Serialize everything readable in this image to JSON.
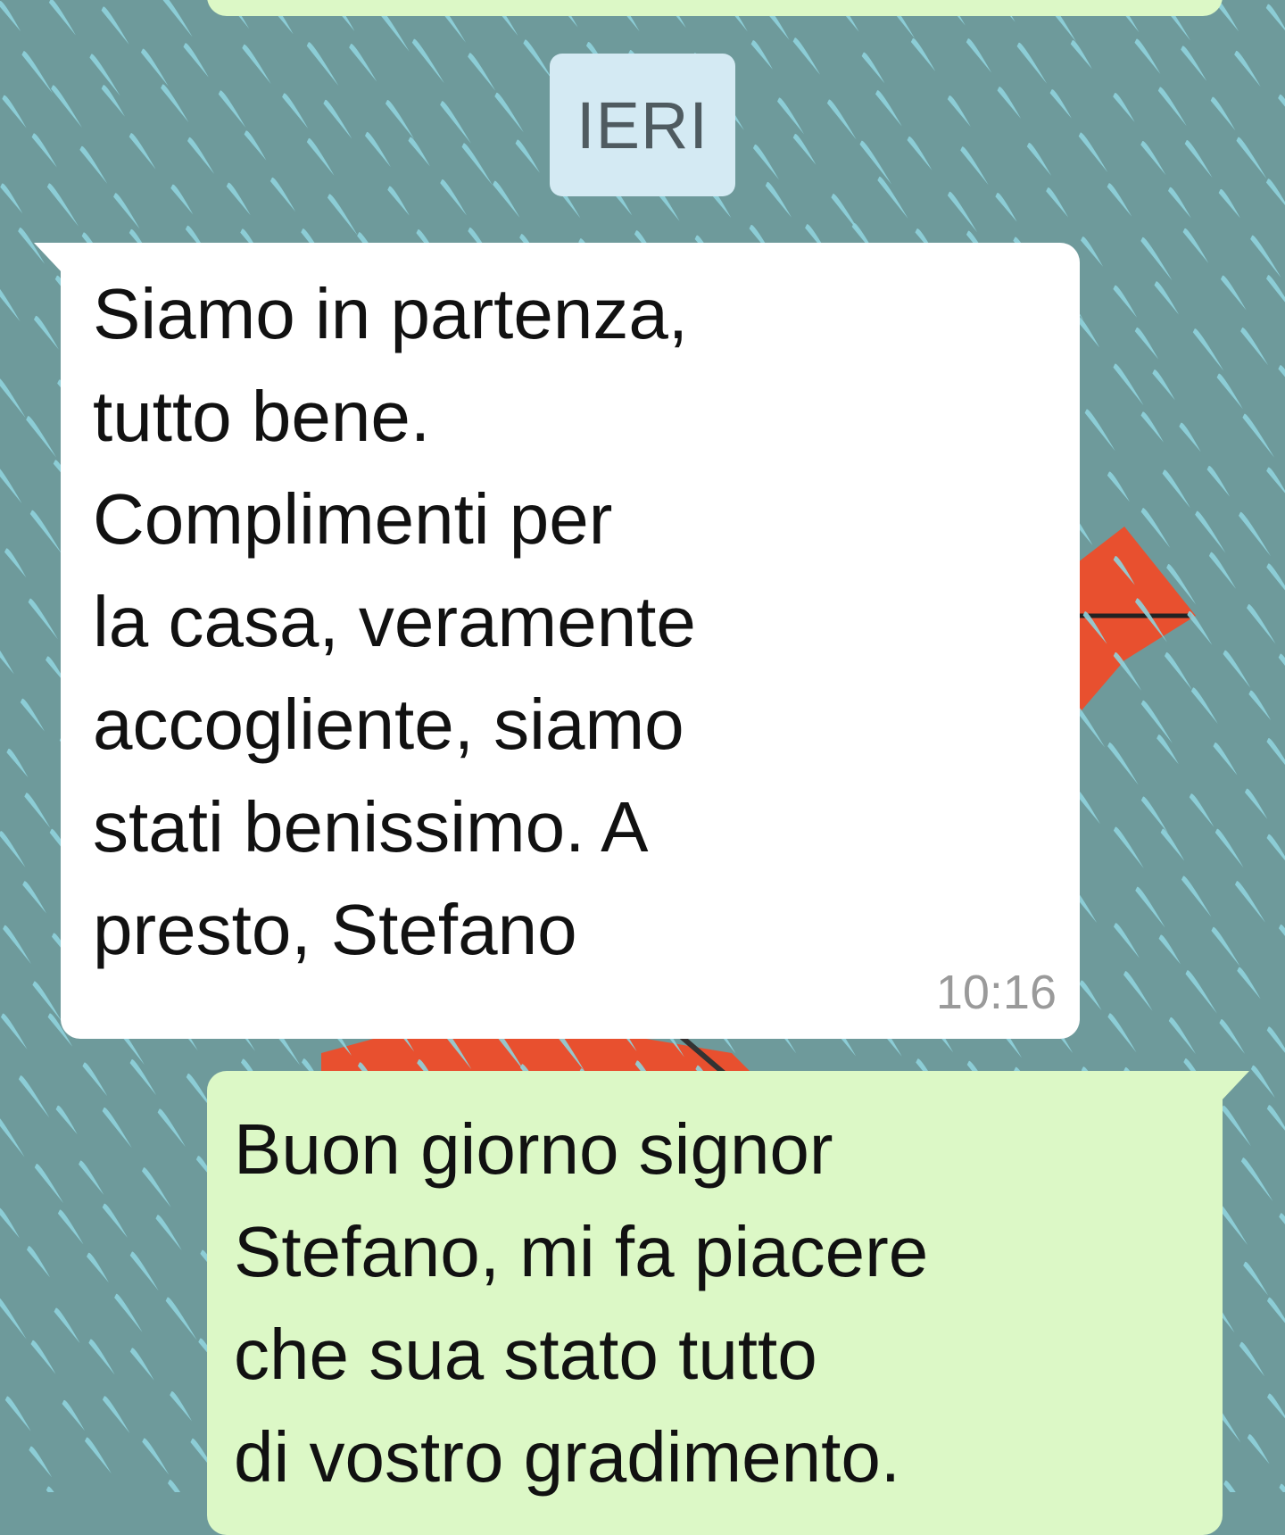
{
  "date_divider": {
    "label": "IERI"
  },
  "incoming_message": {
    "lines": [
      "Siamo in partenza,",
      "tutto bene.",
      "Complimenti per",
      "la casa, veramente",
      "accogliente, siamo",
      "stati benissimo. A",
      "presto, Stefano"
    ],
    "time": "10:16"
  },
  "outgoing_message": {
    "lines": [
      "Buon giorno signor",
      "Stefano, mi fa piacere",
      "che sua stato tutto",
      "di vostro gradimento."
    ]
  },
  "colors": {
    "wallpaper": "#6e9a9b",
    "raindrop": "#8fd3dd",
    "incoming_bubble": "#ffffff",
    "outgoing_bubble": "#dcf8c6",
    "date_chip": "#d4eaf3",
    "umbrella": "#e8502f"
  }
}
